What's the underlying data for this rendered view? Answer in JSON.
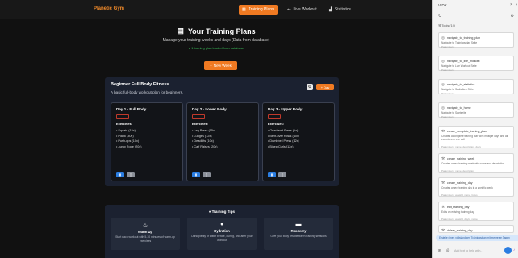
{
  "app": {
    "brand": "Planetic Gym",
    "nav": [
      {
        "label": "Training Plans",
        "icon": "calendar-icon"
      },
      {
        "label": "Live Workout",
        "icon": "dumbbell-icon"
      },
      {
        "label": "Statistics",
        "icon": "chart-icon"
      }
    ],
    "title": "Your Training Plans",
    "subtitle": "Manage your training weeks and days (Data from database)",
    "status": "1 training plan loaded from database",
    "new_week": "New Week",
    "plan": {
      "title": "Beginner Full Body Fitness",
      "description": "A basic full-body workout plan for beginners.",
      "day_button": "Day",
      "exercises_label": "Exercises:",
      "days": [
        {
          "title": "Day 1 - Full Body",
          "exercises": [
            "Squats (15x)",
            "Plank (30s)",
            "Push-ups (10x)",
            "Jump Rope (20x)"
          ]
        },
        {
          "title": "Day 2 - Lower Body",
          "exercises": [
            "Leg Press (15x)",
            "Lunges (12x)",
            "Deadlifts (10x)",
            "Calf Raises (20x)"
          ]
        },
        {
          "title": "Day 3 - Upper Body",
          "exercises": [
            "Overhead Press (8x)",
            "Bent-over Rows (10x)",
            "Dumbbell Press (12x)",
            "Bicep Curls (12x)"
          ]
        }
      ]
    },
    "tips": {
      "title": "Training Tips",
      "items": [
        {
          "name": "Warm Up",
          "text": "Start each workout with 5-10 minutes of warm-up exercises",
          "icon": "flame-icon"
        },
        {
          "name": "Hydration",
          "text": "Drink plenty of water before, during, and after your workout",
          "icon": "droplet-icon"
        },
        {
          "name": "Recovery",
          "text": "Give your body rest between training sessions",
          "icon": "bed-icon"
        }
      ]
    }
  },
  "panel": {
    "title": "VIDX",
    "tools_label": "Tools (10)",
    "tools": [
      {
        "name": "navigate_to_training_plan",
        "desc": "Navigate to Trainingsplan Seite",
        "params": "Parameters:"
      },
      {
        "name": "navigate_to_live_workout",
        "desc": "Navigate to Live Workout Seite",
        "params": "Parameters:"
      },
      {
        "name": "navigate_to_statistics",
        "desc": "Navigate to Statistiken Seite",
        "params": "Parameters:"
      },
      {
        "name": "navigate_to_home",
        "desc": "Navigate to Startseite",
        "params": "Parameters:"
      },
      {
        "name": "create_complete_training_plan",
        "desc": "Creates a complete training plan with multiple days and all exercises in one call",
        "params": "Parameters: name, description, days"
      },
      {
        "name": "create_training_week",
        "desc": "Creates a new training week with name and description",
        "params": "Parameters: name, description"
      },
      {
        "name": "create_training_day",
        "desc": "Creates a new training day in a specific week",
        "params": "Parameters: weekId, name, focus"
      },
      {
        "name": "edit_training_day",
        "desc": "Edits an existing training day",
        "params": "Parameters: weekId, dayId, name"
      },
      {
        "name": "delete_training_day",
        "desc": "",
        "params": ""
      }
    ],
    "bubble": "Erstelle einen vollständigen Trainingsplan mit mehreren Tagen",
    "input_placeholder": "Add text to help with..."
  }
}
